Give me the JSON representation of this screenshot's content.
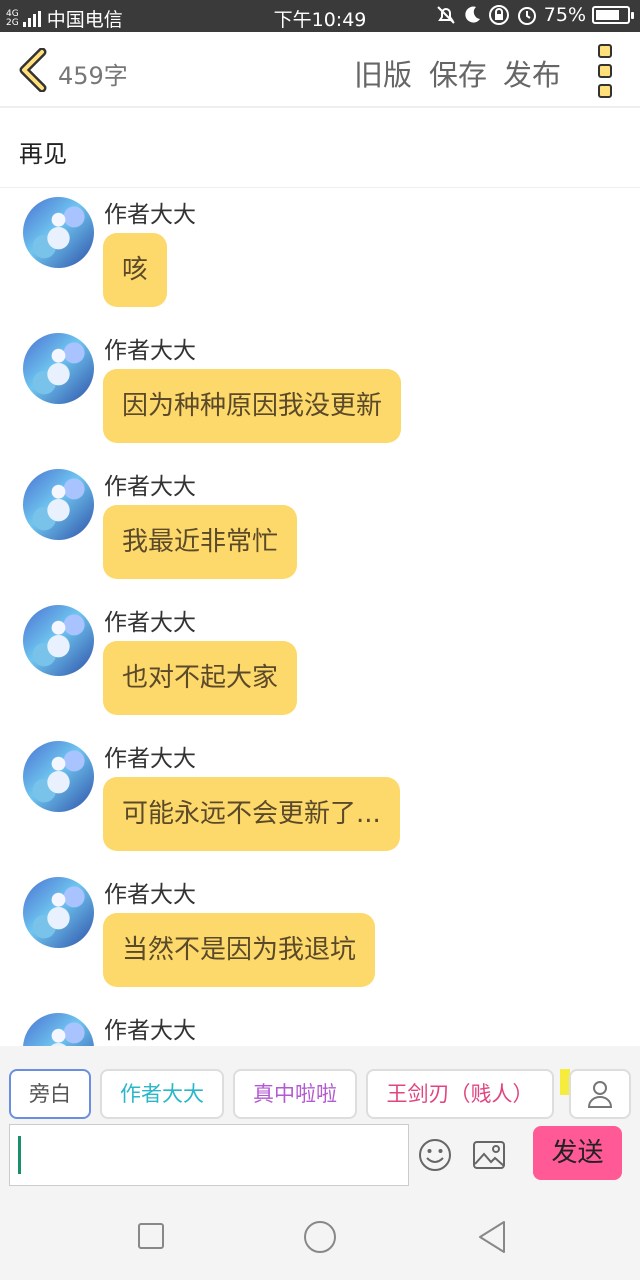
{
  "status_bar": {
    "network_top": "4G",
    "network_bottom": "2G",
    "carrier": "中国电信",
    "time": "下午10:49",
    "battery": "75%",
    "battery_level": 0.75
  },
  "header": {
    "word_count": "459字",
    "old_version": "旧版",
    "save": "保存",
    "publish": "发布"
  },
  "chapter": {
    "title": "再见"
  },
  "messages": [
    {
      "sender": "作者大大",
      "text": "咳"
    },
    {
      "sender": "作者大大",
      "text": "因为种种原因我没更新"
    },
    {
      "sender": "作者大大",
      "text": "我最近非常忙"
    },
    {
      "sender": "作者大大",
      "text": "也对不起大家"
    },
    {
      "sender": "作者大大",
      "text": "可能永远不会更新了..."
    },
    {
      "sender": "作者大大",
      "text": "当然不是因为我退坑"
    },
    {
      "sender": "作者大大",
      "text": ""
    }
  ],
  "roles": [
    {
      "label": "旁白",
      "color": "#555555"
    },
    {
      "label": "作者大大",
      "color": "#2bb7c9"
    },
    {
      "label": "真中啦啦",
      "color": "#b25ad1"
    },
    {
      "label": "王剑刃（贱人）",
      "color": "#e0457f"
    }
  ],
  "composer": {
    "value": "",
    "send_label": "发送"
  },
  "colors": {
    "bubble": "#fdd86a",
    "send": "#ff5a95",
    "selected_chip_border": "#6b8fe0"
  }
}
